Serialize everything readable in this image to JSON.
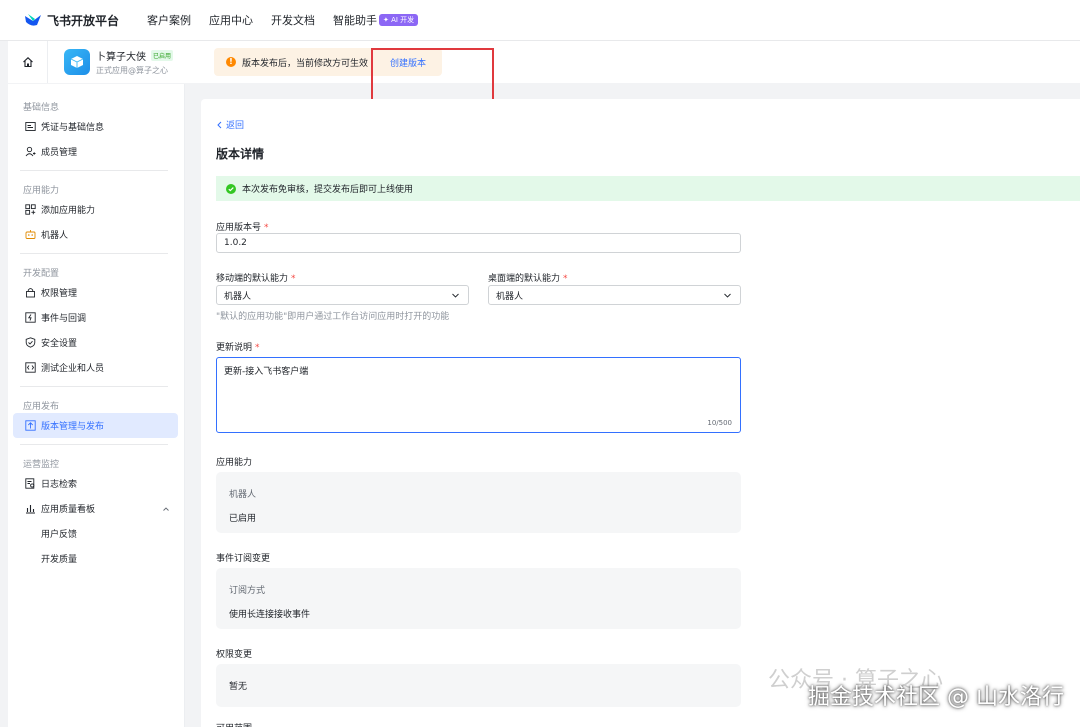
{
  "topnav": {
    "brand": "飞书开放平台",
    "items": [
      "客户案例",
      "应用中心",
      "开发文档",
      "智能助手"
    ],
    "ai_badge": "✦ AI 开发"
  },
  "appbar": {
    "app_name": "卜算子大侠",
    "status": "已启用",
    "app_sub": "正式应用@算子之心",
    "notice_text": "版本发布后，当前修改方可生效",
    "notice_link": "创建版本"
  },
  "sidebar": {
    "groups": [
      {
        "title": "基础信息",
        "items": [
          "凭证与基础信息",
          "成员管理"
        ]
      },
      {
        "title": "应用能力",
        "items": [
          "添加应用能力",
          "机器人"
        ]
      },
      {
        "title": "开发配置",
        "items": [
          "权限管理",
          "事件与回调",
          "安全设置",
          "测试企业和人员"
        ]
      },
      {
        "title": "应用发布",
        "items": [
          "版本管理与发布"
        ]
      },
      {
        "title": "运营监控",
        "items": [
          "日志检索",
          "应用质量看板",
          "用户反馈",
          "开发质量"
        ]
      }
    ]
  },
  "main": {
    "back": "返回",
    "title": "版本详情",
    "success": "本次发布免审核，提交发布后即可上线使用",
    "version_label": "应用版本号",
    "version_value": "1.0.2",
    "mobile_label": "移动端的默认能力",
    "mobile_value": "机器人",
    "desktop_label": "桌面端的默认能力",
    "desktop_value": "机器人",
    "default_hint": "\"默认的应用功能\"即用户通过工作台访问应用时打开的功能",
    "notes_label": "更新说明",
    "notes_value": "更新-接入飞书客户端",
    "notes_counter": "10/500",
    "ability_title": "应用能力",
    "ability_key": "机器人",
    "ability_val": "已启用",
    "event_title": "事件订阅变更",
    "event_key": "订阅方式",
    "event_val": "使用长连接接收事件",
    "perm_title": "权限变更",
    "perm_val": "暂无",
    "next_title": "可用范围"
  },
  "watermark": {
    "faint": "公众号 · 算子之心",
    "main": "掘金技术社区 @ 山水洛行"
  },
  "colors": {
    "accent": "#3370ff",
    "success": "#34c724",
    "warning": "#ff8800",
    "highlight_box": "#e0393e"
  }
}
